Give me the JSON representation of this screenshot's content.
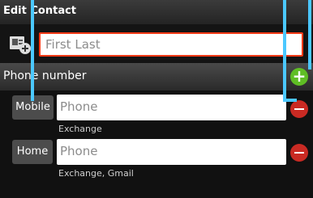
{
  "header": {
    "title": "Edit Contact"
  },
  "name": {
    "placeholder": "First Last"
  },
  "phone_section": {
    "label": "Phone number"
  },
  "entries": [
    {
      "type": "Mobile",
      "placeholder": "Phone",
      "account": "Exchange"
    },
    {
      "type": "Home",
      "placeholder": "Phone",
      "account": "Exchange, Gmail"
    }
  ],
  "colors": {
    "accent": "#ff3a16",
    "add": "#5fbe24",
    "remove": "#c92a23",
    "pointer": "#4bc8ff"
  },
  "icons": {
    "contact": "contact-card-add-icon",
    "add": "plus-icon",
    "remove": "minus-icon"
  }
}
